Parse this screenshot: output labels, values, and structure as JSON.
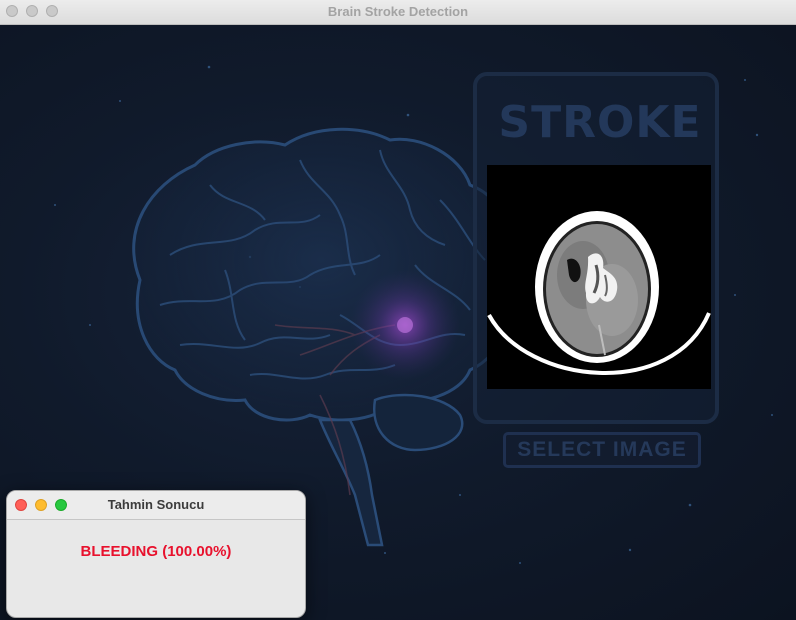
{
  "window": {
    "title": "Brain Stroke Detection"
  },
  "card": {
    "title": "STROKE",
    "select_button": "SELECT IMAGE"
  },
  "dialog": {
    "title": "Tahmin Sonucu",
    "result": "BLEEDING (100.00%)"
  },
  "colors": {
    "result": "#e8112d",
    "background": "#0f1624",
    "card_text": "#23385a"
  }
}
